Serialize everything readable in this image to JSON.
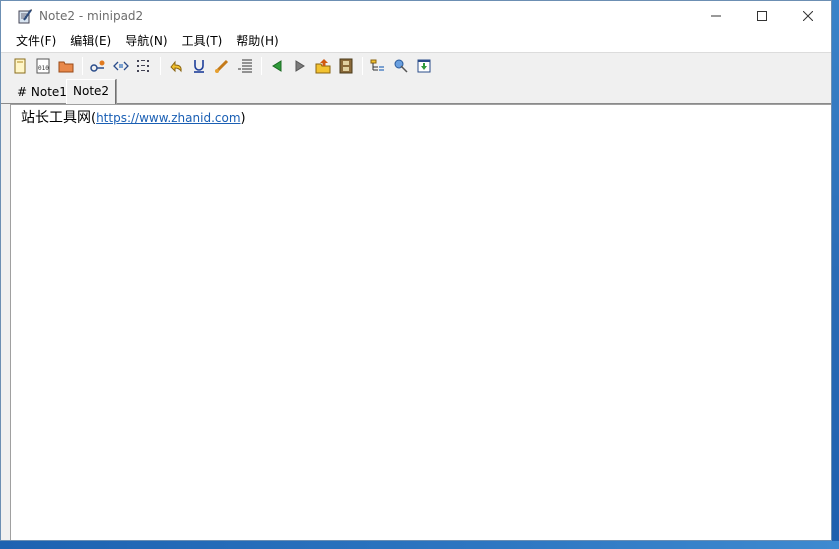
{
  "window": {
    "title": "Note2 - minipad2",
    "controls": {
      "minimize": "—",
      "maximize": "☐",
      "close": "✕"
    }
  },
  "menu": {
    "items": [
      {
        "label": "文件(F)"
      },
      {
        "label": "编辑(E)"
      },
      {
        "label": "导航(N)"
      },
      {
        "label": "工具(T)"
      },
      {
        "label": "帮助(H)"
      }
    ]
  },
  "tabs": [
    {
      "label": "# Note1",
      "active": false
    },
    {
      "label": "Note2",
      "active": true
    }
  ],
  "editor": {
    "text_prefix": "站长工具网",
    "paren_open": "(",
    "link_text": "https://www.zhanid.com",
    "paren_close": ")"
  },
  "colors": {
    "link": "#1a5fb4",
    "desktop": "#2a6fb8"
  }
}
